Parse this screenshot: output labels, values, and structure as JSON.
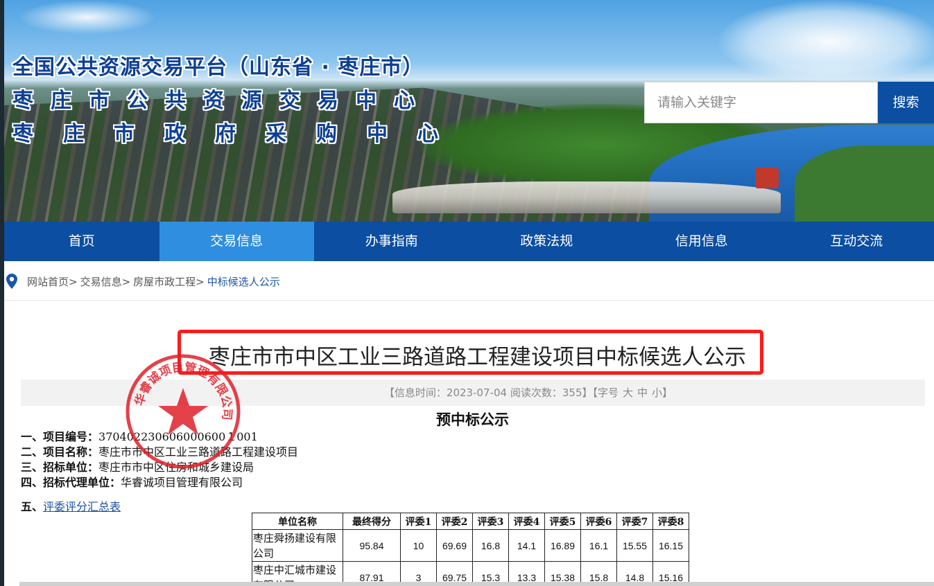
{
  "header": {
    "title_lines": [
      "全国公共资源交易平台（山东省 · 枣庄市）",
      "枣庄市公共资源交易中心",
      "枣庄市政府采购中心"
    ],
    "search_placeholder": "请输入关键字",
    "search_button": "搜索"
  },
  "nav": {
    "items": [
      "首页",
      "交易信息",
      "办事指南",
      "政策法规",
      "信用信息",
      "互动交流"
    ],
    "active_index": 1
  },
  "breadcrumb": [
    "网站首页>",
    "交易信息>",
    "房屋市政工程>",
    "中标候选人公示"
  ],
  "article": {
    "title": "枣庄市市中区工业三路道路工程建设项目中标候选人公示",
    "meta_text": "【信息时间：2023-07-04   阅读次数：355】【字号",
    "font_sizes": [
      "大",
      "中",
      "小"
    ],
    "meta_close": "】",
    "doc_title": "预中标公示",
    "lines": [
      {
        "label": "一、项目编号：",
        "value": "370402230606000600１001"
      },
      {
        "label": "二、项目名称：",
        "value": "枣庄市市中区工业三路道路工程建设项目"
      },
      {
        "label": "三、招标单位：",
        "value": "枣庄市市中区住房和城乡建设局"
      },
      {
        "label": "四、招标代理单位：",
        "value": "华睿诚项目管理有限公司"
      }
    ],
    "section5_label": "五、",
    "section5_link": "评委评分汇总表"
  },
  "score_table": {
    "headers": [
      "单位名称",
      "最终得分",
      "评委1",
      "评委2",
      "评委3",
      "评委4",
      "评委5",
      "评委6",
      "评委7",
      "评委8"
    ],
    "rows": [
      [
        "枣庄舜扬建设有限公司",
        "95.84",
        "10",
        "69.69",
        "16.8",
        "14.1",
        "16.89",
        "16.1",
        "15.55",
        "16.15"
      ],
      [
        "枣庄中汇城市建设有限公司",
        "87.91",
        "3",
        "69.75",
        "15.3",
        "13.3",
        "15.38",
        "15.8",
        "14.8",
        "15.16"
      ]
    ]
  },
  "stamp": {
    "text": "华睿诚项目管理有限公司"
  },
  "colors": {
    "nav_bg": "#0b4ea2",
    "nav_active": "#2f8ee0",
    "highlight_frame": "#ff1b1b",
    "stamp": "#e0202a"
  }
}
